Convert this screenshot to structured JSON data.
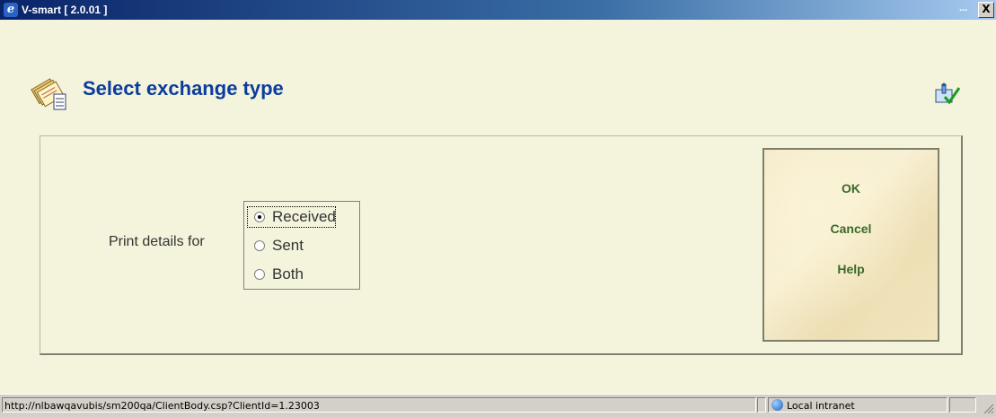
{
  "window": {
    "title": "V-smart [ 2.0.01 ]",
    "minimize_label": "...",
    "close_label": "X"
  },
  "header": {
    "title": "Select exchange type"
  },
  "form": {
    "label": "Print details for",
    "options": [
      {
        "label": "Received",
        "selected": true
      },
      {
        "label": "Sent",
        "selected": false
      },
      {
        "label": "Both",
        "selected": false
      }
    ]
  },
  "buttons": {
    "ok": "OK",
    "cancel": "Cancel",
    "help": "Help"
  },
  "statusbar": {
    "url": "http://nlbawqavubis/sm200qa/ClientBody.csp?ClientId=1.23003",
    "zone": "Local intranet"
  },
  "colors": {
    "title_blue": "#0b3c9e",
    "button_green": "#3a6a2a",
    "background": "#f4f4dc"
  },
  "icons": {
    "app": "ie-icon",
    "page": "documents-icon",
    "action": "wizard-check-icon",
    "zone": "globe-icon"
  }
}
